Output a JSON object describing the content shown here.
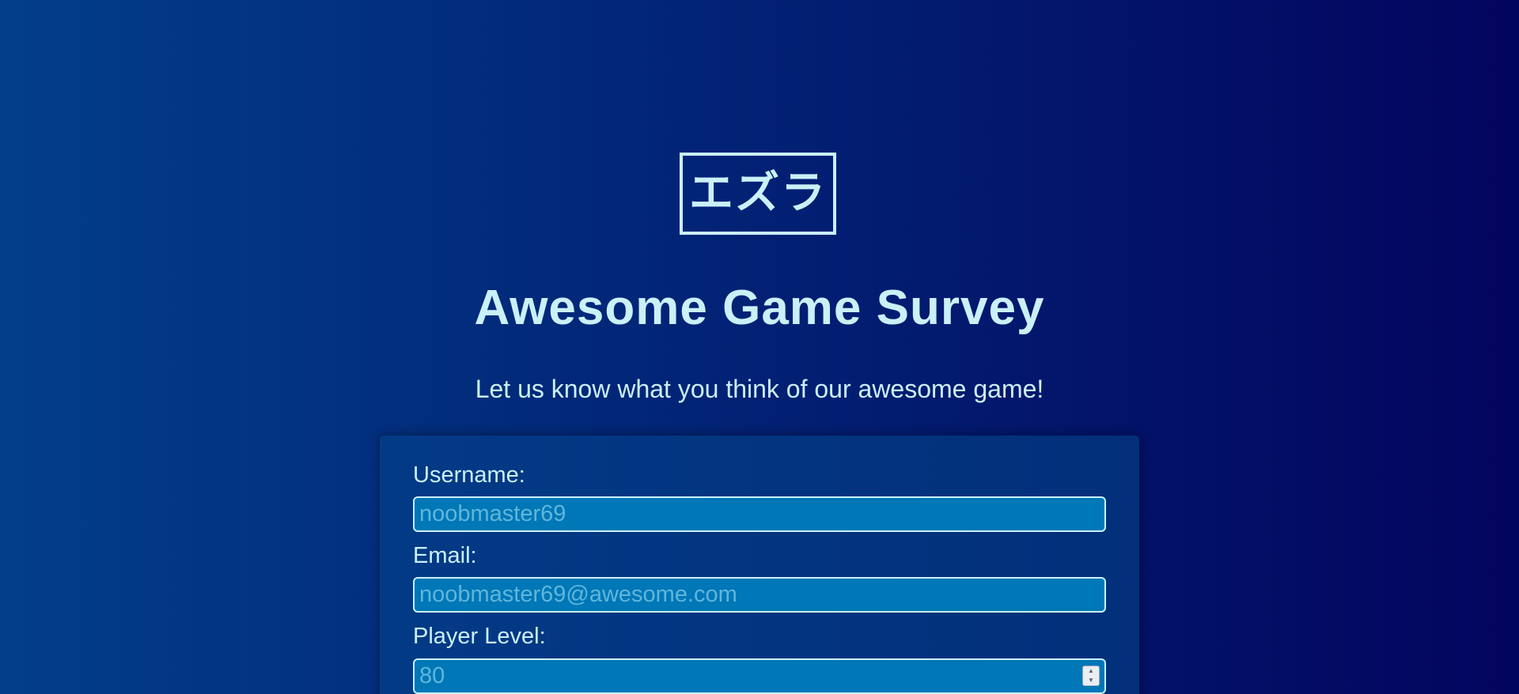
{
  "header": {
    "logo_text": "エズラ",
    "title": "Awesome Game Survey",
    "description": "Let us know what you think of our awesome game!"
  },
  "form": {
    "username": {
      "label": "Username:",
      "placeholder": "noobmaster69"
    },
    "email": {
      "label": "Email:",
      "placeholder": "noobmaster69@awesome.com"
    },
    "player_level": {
      "label": "Player Level:",
      "placeholder": "80",
      "stepper_up": "▲",
      "stepper_down": "▼"
    }
  },
  "colors": {
    "background_start": "#023e8a",
    "background_end": "#03045e",
    "text": "#caf0f8",
    "input_background": "#0077b6",
    "placeholder": "#5fb6dc"
  }
}
